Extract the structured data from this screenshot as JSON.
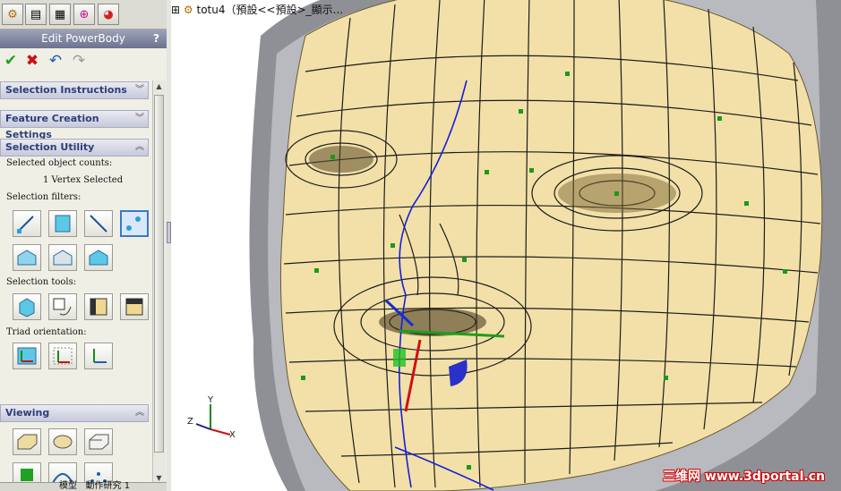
{
  "panel": {
    "title": "Edit PowerBody",
    "help": "?",
    "actions": {
      "ok": "✔",
      "cancel": "✖",
      "undo": "↶",
      "redo": "↷"
    },
    "sections": {
      "selection_instructions": "Selection Instructions",
      "feature_creation_settings": "Feature Creation Settings",
      "selection_utility": "Selection Utility",
      "viewing": "Viewing"
    },
    "selected_counts_label": "Selected object counts:",
    "selected_value": "1 Vertex Selected",
    "filters_label": "Selection filters:",
    "tools_label": "Selection tools:",
    "triad_label": "Triad orientation:"
  },
  "viewport": {
    "tree_expander": "⊞",
    "tree_label": "totu4（預設<<預設>_顯示...",
    "watermark": "三维网 www.3dportal.cn"
  },
  "triad": {
    "x": "X",
    "y": "Y",
    "z": "Z"
  },
  "bottom": {
    "tab1": "模型",
    "tab2": "動作研究 1"
  },
  "colors": {
    "face": "#f2e0a8",
    "hood": "#8e9096",
    "accent": "#3a78c8",
    "title_bar": "#6d7290"
  }
}
